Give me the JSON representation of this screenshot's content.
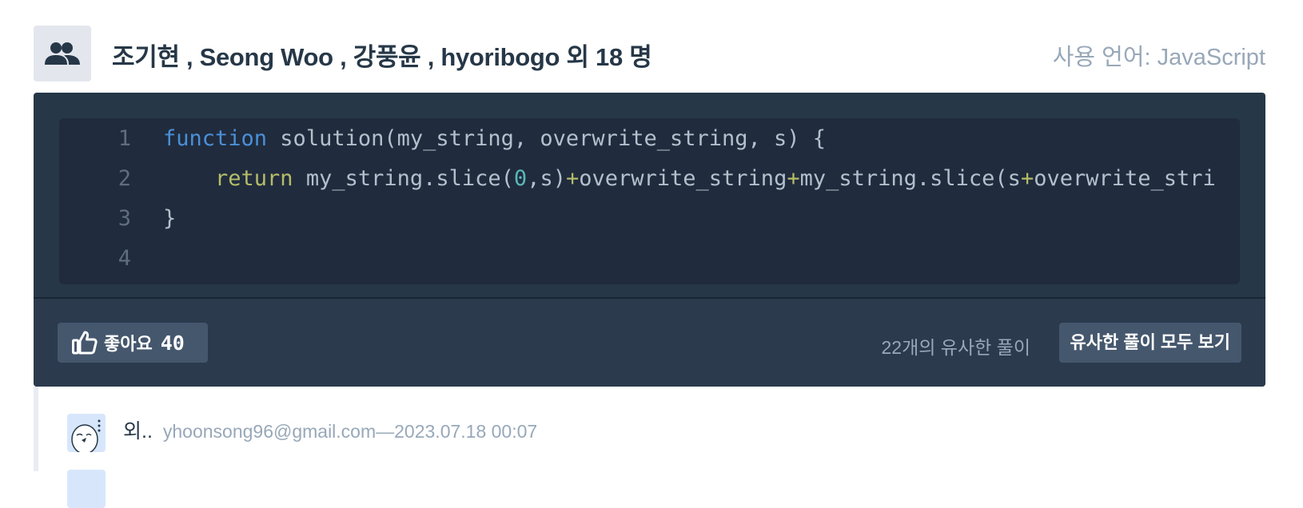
{
  "header": {
    "authors": "조기현 , Seong Woo , 강풍윤 , hyoribogo 외 18 명",
    "language_label": "사용 언어: JavaScript",
    "group_icon": "people-group-icon"
  },
  "code": {
    "lines": [
      {
        "number": "1",
        "parts": [
          {
            "t": "function",
            "c": "kw"
          },
          {
            "t": " solution(my_string, overwrite_string, s) {",
            "c": ""
          }
        ]
      },
      {
        "number": "2",
        "parts": [
          {
            "t": "    ",
            "c": ""
          },
          {
            "t": "return",
            "c": "ret"
          },
          {
            "t": " my_string.slice(",
            "c": ""
          },
          {
            "t": "0",
            "c": "num"
          },
          {
            "t": ",s)",
            "c": ""
          },
          {
            "t": "+",
            "c": "op"
          },
          {
            "t": "overwrite_string",
            "c": ""
          },
          {
            "t": "+",
            "c": "op"
          },
          {
            "t": "my_string.slice(s",
            "c": ""
          },
          {
            "t": "+",
            "c": "op"
          },
          {
            "t": "overwrite_stri",
            "c": ""
          }
        ]
      },
      {
        "number": "3",
        "parts": [
          {
            "t": "}",
            "c": ""
          }
        ]
      },
      {
        "number": "4",
        "parts": []
      }
    ]
  },
  "footer": {
    "like_label": "좋아요",
    "like_count": "40",
    "like_icon": "thumbs-up-icon",
    "similar_count": "22개의 유사한 풀이",
    "similar_button": "유사한 풀이 모두 보기"
  },
  "comments": [
    {
      "text": "외..",
      "author": "yhoonsong96@gmail.com",
      "separator": "—",
      "date": "2023.07.18 00:07"
    }
  ],
  "colors": {
    "panel": "#263747",
    "code_bg": "#202b3d",
    "keyword": "#4a90d9",
    "return": "#b5bd68",
    "number": "#5ab7b7",
    "muted": "#98a8b9"
  }
}
